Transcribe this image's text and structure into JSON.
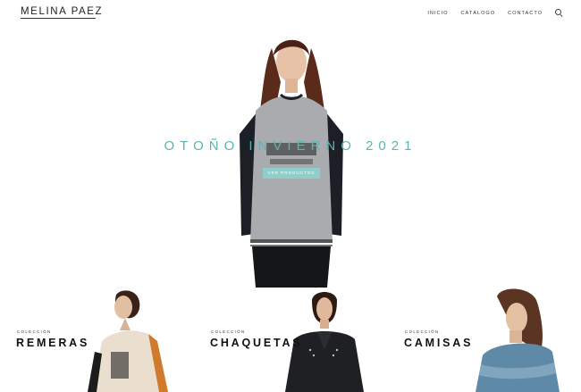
{
  "header": {
    "logo": "MELINA PAEZ",
    "nav": [
      {
        "label": "INICIO"
      },
      {
        "label": "CATÁLOGO"
      },
      {
        "label": "CONTACTO"
      }
    ],
    "search_icon": "search-icon"
  },
  "hero": {
    "title": "OTOÑO INVIERNO 2021",
    "button_label": "VER PRODUCTOS",
    "accent_color": "#5ab5b0",
    "button_color": "#8fcfcb"
  },
  "collections": [
    {
      "eyebrow": "COLECCIÓN",
      "title": "REMERAS"
    },
    {
      "eyebrow": "COLECCIÓN",
      "title": "CHAQUETAS"
    },
    {
      "eyebrow": "COLECCIÓN",
      "title": "CAMISAS"
    }
  ]
}
